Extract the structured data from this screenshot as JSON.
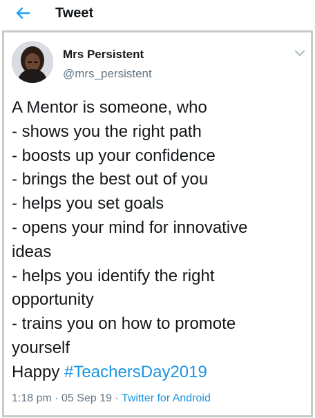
{
  "header": {
    "title": "Tweet",
    "back_icon": "back-arrow-icon",
    "accent": "#1da1f2"
  },
  "tweet": {
    "author_name": "Mrs Persistent",
    "author_handle": "@mrs_persistent",
    "menu_icon": "chevron-down-icon",
    "lines": [
      "A Mentor is someone, who",
      "- shows you the right path",
      "- boosts up your confidence",
      "- brings the best out of you",
      "- helps you set goals",
      "- opens your mind for innovative",
      "ideas",
      "- helps you identify the right",
      "opportunity",
      "- trains you on how to promote",
      "yourself"
    ],
    "closing_text": "Happy ",
    "hashtag": "#TeachersDay2019",
    "time": "1:18 pm",
    "separator": " · ",
    "date": "05 Sep 19",
    "source": "Twitter for Android",
    "link_color": "#1b95e0"
  }
}
